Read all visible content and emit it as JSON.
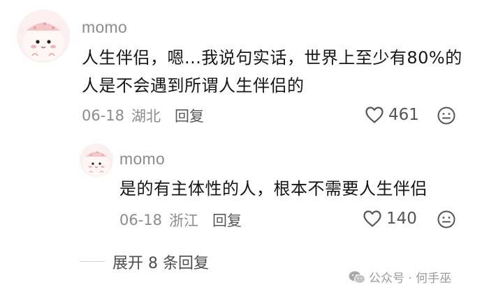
{
  "comments": [
    {
      "username": "momo",
      "text": "人生伴侣，嗯...我说句实话，世界上至少有80%的人是不会遇到所谓人生伴侣的",
      "date": "06-18",
      "location": "湖北",
      "reply_label": "回复",
      "likes": "461",
      "avatar_icon": "pink-cartoon-face-avatar"
    },
    {
      "username": "momo",
      "text": "是的有主体性的人，根本不需要人生伴侣",
      "date": "06-18",
      "location": "浙江",
      "reply_label": "回复",
      "likes": "140",
      "avatar_icon": "pink-cartoon-face-avatar"
    }
  ],
  "expand_replies_label": "展开 8 条回复",
  "watermark": {
    "text": "公众号 · 何手巫",
    "icon": "wechat-icon"
  },
  "colors": {
    "meta_gray": "#8c8c8c",
    "text_dark": "#161616",
    "avatar_pink": "#fbeff0"
  }
}
